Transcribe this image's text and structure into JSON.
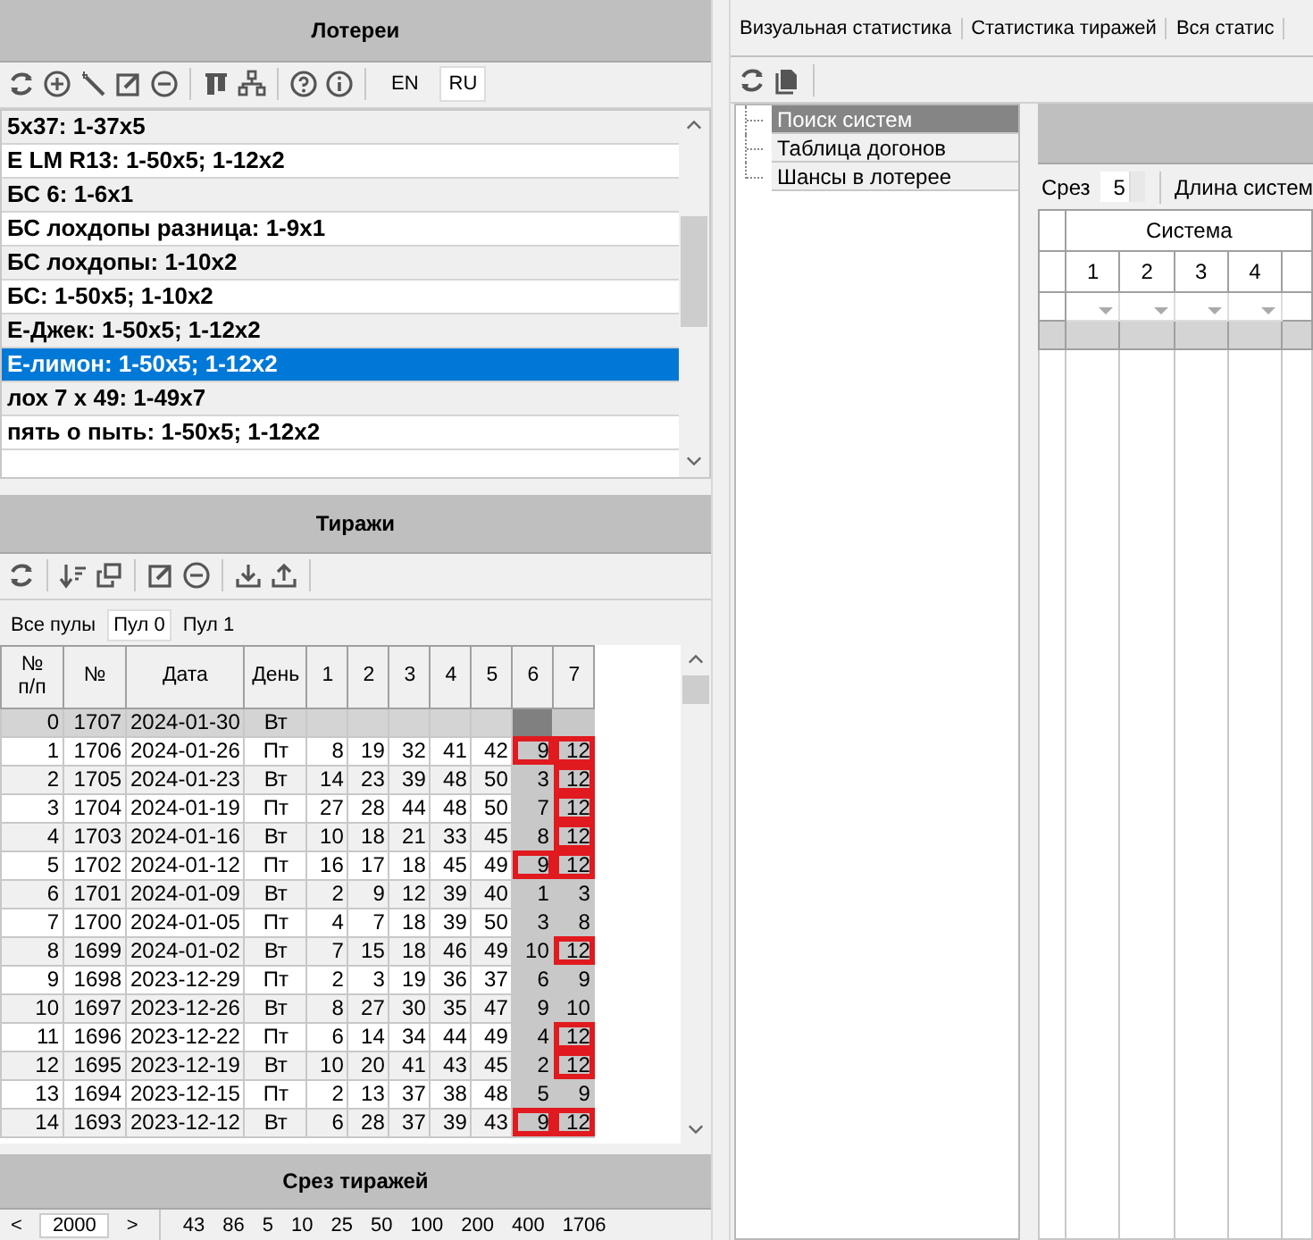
{
  "lotteries": {
    "title": "Лотереи",
    "toolbar": [
      {
        "kind": "refresh"
      },
      {
        "kind": "add"
      },
      {
        "kind": "wand"
      },
      {
        "kind": "edit"
      },
      {
        "kind": "remove"
      },
      {
        "kind": "sep"
      },
      {
        "kind": "columns"
      },
      {
        "kind": "tree"
      },
      {
        "kind": "sep"
      },
      {
        "kind": "help"
      },
      {
        "kind": "info"
      },
      {
        "kind": "sep"
      }
    ],
    "languages": [
      {
        "label": "EN",
        "selected": false
      },
      {
        "label": "RU",
        "selected": true
      }
    ],
    "items": [
      {
        "label": "5x37: 1-37x5",
        "selected": false
      },
      {
        "label": "E  LM R13: 1-50x5; 1-12x2",
        "selected": false
      },
      {
        "label": "БС 6: 1-6x1",
        "selected": false
      },
      {
        "label": "БС лохдопы разница: 1-9x1",
        "selected": false
      },
      {
        "label": "БС лохдопы: 1-10x2",
        "selected": false
      },
      {
        "label": "БС: 1-50x5; 1-10x2",
        "selected": false
      },
      {
        "label": "Е-Джек: 1-50x5; 1-12x2",
        "selected": false
      },
      {
        "label": "Е-лимон: 1-50x5; 1-12x2",
        "selected": true
      },
      {
        "label": "лох 7 х 49: 1-49x7",
        "selected": false
      },
      {
        "label": "пять о пыть: 1-50x5; 1-12x2",
        "selected": false
      }
    ]
  },
  "draws": {
    "title": "Тиражи",
    "toolbar": [
      {
        "kind": "refresh"
      },
      {
        "kind": "sep"
      },
      {
        "kind": "sort"
      },
      {
        "kind": "copy"
      },
      {
        "kind": "sep"
      },
      {
        "kind": "edit"
      },
      {
        "kind": "remove"
      },
      {
        "kind": "sep"
      },
      {
        "kind": "download"
      },
      {
        "kind": "upload"
      },
      {
        "kind": "sep"
      }
    ],
    "pools": [
      {
        "label": "Все пулы",
        "selected": false
      },
      {
        "label": "Пул 0",
        "selected": true
      },
      {
        "label": "Пул 1",
        "selected": false
      }
    ],
    "columns": [
      "№\nп/п",
      "№",
      "Дата",
      "День",
      "1",
      "2",
      "3",
      "4",
      "5",
      "6",
      "7"
    ],
    "rows": [
      {
        "cells": [
          "0",
          "1707",
          "2024-01-30",
          "Вт"
        ],
        "balls": [],
        "selected": true
      },
      {
        "cells": [
          "1",
          "1706",
          "2024-01-26",
          "Пт"
        ],
        "balls": [
          {
            "value": "8",
            "marked": false
          },
          {
            "value": "19",
            "marked": false
          },
          {
            "value": "32",
            "marked": false
          },
          {
            "value": "41",
            "marked": false
          },
          {
            "value": "42",
            "marked": false
          },
          {
            "value": "9",
            "marked": true
          },
          {
            "value": "12",
            "marked": true
          }
        ],
        "selected": false
      },
      {
        "cells": [
          "2",
          "1705",
          "2024-01-23",
          "Вт"
        ],
        "balls": [
          {
            "value": "14",
            "marked": false
          },
          {
            "value": "23",
            "marked": false
          },
          {
            "value": "39",
            "marked": false
          },
          {
            "value": "48",
            "marked": false
          },
          {
            "value": "50",
            "marked": false
          },
          {
            "value": "3",
            "marked": false
          },
          {
            "value": "12",
            "marked": true
          }
        ],
        "selected": false
      },
      {
        "cells": [
          "3",
          "1704",
          "2024-01-19",
          "Пт"
        ],
        "balls": [
          {
            "value": "27",
            "marked": false
          },
          {
            "value": "28",
            "marked": false
          },
          {
            "value": "44",
            "marked": false
          },
          {
            "value": "48",
            "marked": false
          },
          {
            "value": "50",
            "marked": false
          },
          {
            "value": "7",
            "marked": false
          },
          {
            "value": "12",
            "marked": true
          }
        ],
        "selected": false
      },
      {
        "cells": [
          "4",
          "1703",
          "2024-01-16",
          "Вт"
        ],
        "balls": [
          {
            "value": "10",
            "marked": false
          },
          {
            "value": "18",
            "marked": false
          },
          {
            "value": "21",
            "marked": false
          },
          {
            "value": "33",
            "marked": false
          },
          {
            "value": "45",
            "marked": false
          },
          {
            "value": "8",
            "marked": false
          },
          {
            "value": "12",
            "marked": true
          }
        ],
        "selected": false
      },
      {
        "cells": [
          "5",
          "1702",
          "2024-01-12",
          "Пт"
        ],
        "balls": [
          {
            "value": "16",
            "marked": false
          },
          {
            "value": "17",
            "marked": false
          },
          {
            "value": "18",
            "marked": false
          },
          {
            "value": "45",
            "marked": false
          },
          {
            "value": "49",
            "marked": false
          },
          {
            "value": "9",
            "marked": true
          },
          {
            "value": "12",
            "marked": true
          }
        ],
        "selected": false
      },
      {
        "cells": [
          "6",
          "1701",
          "2024-01-09",
          "Вт"
        ],
        "balls": [
          {
            "value": "2",
            "marked": false
          },
          {
            "value": "9",
            "marked": false
          },
          {
            "value": "12",
            "marked": false
          },
          {
            "value": "39",
            "marked": false
          },
          {
            "value": "40",
            "marked": false
          },
          {
            "value": "1",
            "marked": false
          },
          {
            "value": "3",
            "marked": false
          }
        ],
        "selected": false
      },
      {
        "cells": [
          "7",
          "1700",
          "2024-01-05",
          "Пт"
        ],
        "balls": [
          {
            "value": "4",
            "marked": false
          },
          {
            "value": "7",
            "marked": false
          },
          {
            "value": "18",
            "marked": false
          },
          {
            "value": "39",
            "marked": false
          },
          {
            "value": "50",
            "marked": false
          },
          {
            "value": "3",
            "marked": false
          },
          {
            "value": "8",
            "marked": false
          }
        ],
        "selected": false
      },
      {
        "cells": [
          "8",
          "1699",
          "2024-01-02",
          "Вт"
        ],
        "balls": [
          {
            "value": "7",
            "marked": false
          },
          {
            "value": "15",
            "marked": false
          },
          {
            "value": "18",
            "marked": false
          },
          {
            "value": "46",
            "marked": false
          },
          {
            "value": "49",
            "marked": false
          },
          {
            "value": "10",
            "marked": false
          },
          {
            "value": "12",
            "marked": true
          }
        ],
        "selected": false
      },
      {
        "cells": [
          "9",
          "1698",
          "2023-12-29",
          "Пт"
        ],
        "balls": [
          {
            "value": "2",
            "marked": false
          },
          {
            "value": "3",
            "marked": false
          },
          {
            "value": "19",
            "marked": false
          },
          {
            "value": "36",
            "marked": false
          },
          {
            "value": "37",
            "marked": false
          },
          {
            "value": "6",
            "marked": false
          },
          {
            "value": "9",
            "marked": false
          }
        ],
        "selected": false
      },
      {
        "cells": [
          "10",
          "1697",
          "2023-12-26",
          "Вт"
        ],
        "balls": [
          {
            "value": "8",
            "marked": false
          },
          {
            "value": "27",
            "marked": false
          },
          {
            "value": "30",
            "marked": false
          },
          {
            "value": "35",
            "marked": false
          },
          {
            "value": "47",
            "marked": false
          },
          {
            "value": "9",
            "marked": false
          },
          {
            "value": "10",
            "marked": false
          }
        ],
        "selected": false
      },
      {
        "cells": [
          "11",
          "1696",
          "2023-12-22",
          "Пт"
        ],
        "balls": [
          {
            "value": "6",
            "marked": false
          },
          {
            "value": "14",
            "marked": false
          },
          {
            "value": "34",
            "marked": false
          },
          {
            "value": "44",
            "marked": false
          },
          {
            "value": "49",
            "marked": false
          },
          {
            "value": "4",
            "marked": false
          },
          {
            "value": "12",
            "marked": true
          }
        ],
        "selected": false
      },
      {
        "cells": [
          "12",
          "1695",
          "2023-12-19",
          "Вт"
        ],
        "balls": [
          {
            "value": "10",
            "marked": false
          },
          {
            "value": "20",
            "marked": false
          },
          {
            "value": "41",
            "marked": false
          },
          {
            "value": "43",
            "marked": false
          },
          {
            "value": "45",
            "marked": false
          },
          {
            "value": "2",
            "marked": false
          },
          {
            "value": "12",
            "marked": true
          }
        ],
        "selected": false
      },
      {
        "cells": [
          "13",
          "1694",
          "2023-12-15",
          "Пт"
        ],
        "balls": [
          {
            "value": "2",
            "marked": false
          },
          {
            "value": "13",
            "marked": false
          },
          {
            "value": "37",
            "marked": false
          },
          {
            "value": "38",
            "marked": false
          },
          {
            "value": "48",
            "marked": false
          },
          {
            "value": "5",
            "marked": false
          },
          {
            "value": "9",
            "marked": false
          }
        ],
        "selected": false
      },
      {
        "cells": [
          "14",
          "1693",
          "2023-12-12",
          "Вт"
        ],
        "balls": [
          {
            "value": "6",
            "marked": false
          },
          {
            "value": "28",
            "marked": false
          },
          {
            "value": "37",
            "marked": false
          },
          {
            "value": "39",
            "marked": false
          },
          {
            "value": "43",
            "marked": false
          },
          {
            "value": "9",
            "marked": true
          },
          {
            "value": "12",
            "marked": true
          }
        ],
        "selected": false
      }
    ]
  },
  "slice": {
    "title": "Срез тиражей",
    "prev": "<",
    "value": "2000",
    "next": ">",
    "presets": [
      "43",
      "86",
      "5",
      "10",
      "25",
      "50",
      "100",
      "200",
      "400",
      "1706"
    ]
  },
  "stats": {
    "tabs": [
      {
        "label": "Визуальная статистика",
        "selected": false
      },
      {
        "label": "Статистика тиражей",
        "selected": false
      },
      {
        "label": "Вся статис",
        "selected": false
      }
    ],
    "toolbar": [
      {
        "kind": "refresh"
      },
      {
        "kind": "pages"
      },
      {
        "kind": "sep"
      }
    ],
    "tree": [
      {
        "label": "Поиск систем",
        "selected": true
      },
      {
        "label": "Таблица догонов",
        "selected": false
      },
      {
        "label": "Шансы в лотерее",
        "selected": false
      }
    ],
    "slice_label": "Срез",
    "slice_value": "5",
    "length_label": "Длина систем",
    "group_header": "Система",
    "columns": [
      "1",
      "2",
      "3",
      "4"
    ]
  }
}
